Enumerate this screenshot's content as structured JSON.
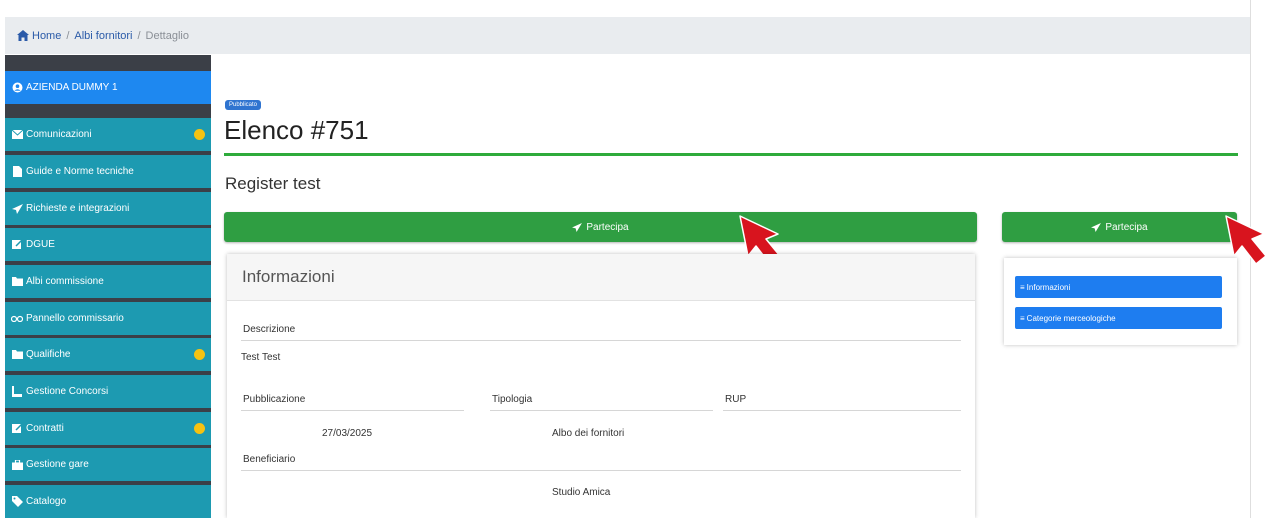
{
  "breadcrumb": {
    "home": "Home",
    "level2": "Albi fornitori",
    "current": "Dettaglio"
  },
  "sidebar": {
    "company": "AZIENDA DUMMY 1",
    "items": [
      {
        "label": "Comunicazioni",
        "icon": "envelope-icon",
        "dot": true
      },
      {
        "label": "Guide e Norme tecniche",
        "icon": "file-icon",
        "dot": false
      },
      {
        "label": "Richieste e integrazioni",
        "icon": "paper-plane-icon",
        "dot": false
      },
      {
        "label": "DGUE",
        "icon": "edit-icon",
        "dot": false
      },
      {
        "label": "Albi commissione",
        "icon": "folder-icon",
        "dot": false
      },
      {
        "label": "Pannello commissario",
        "icon": "glasses-icon",
        "dot": false
      },
      {
        "label": "Qualifiche",
        "icon": "folder-icon",
        "dot": true
      },
      {
        "label": "Gestione Concorsi",
        "icon": "chair-icon",
        "dot": false
      },
      {
        "label": "Contratti",
        "icon": "edit-icon",
        "dot": true
      },
      {
        "label": "Gestione gare",
        "icon": "briefcase-icon",
        "dot": false
      },
      {
        "label": "Catalogo",
        "icon": "tag-icon",
        "dot": false
      }
    ]
  },
  "main": {
    "badge": "Pubblicato",
    "title": "Elenco #751",
    "subtitle": "Register test",
    "participate_label": "Partecipa",
    "info": {
      "heading": "Informazioni",
      "descrizione_label": "Descrizione",
      "descrizione_value": "Test Test",
      "pubblicazione_label": "Pubblicazione",
      "tipologia_label": "Tipologia",
      "rup_label": "RUP",
      "pubblicazione_value": "27/03/2025",
      "tipologia_value": "Albo dei fornitori",
      "beneficiario_label": "Beneficiario",
      "beneficiario_value": "Studio Amica"
    }
  },
  "side_panel": {
    "participate_label": "Partecipa",
    "links": [
      "Informazioni",
      "Categorie merceologiche"
    ]
  },
  "colors": {
    "green": "#2f9e42",
    "teal": "#1d9ab1",
    "blue": "#1e88f0",
    "dot": "#f5c211",
    "arrow": "#d8141e"
  }
}
